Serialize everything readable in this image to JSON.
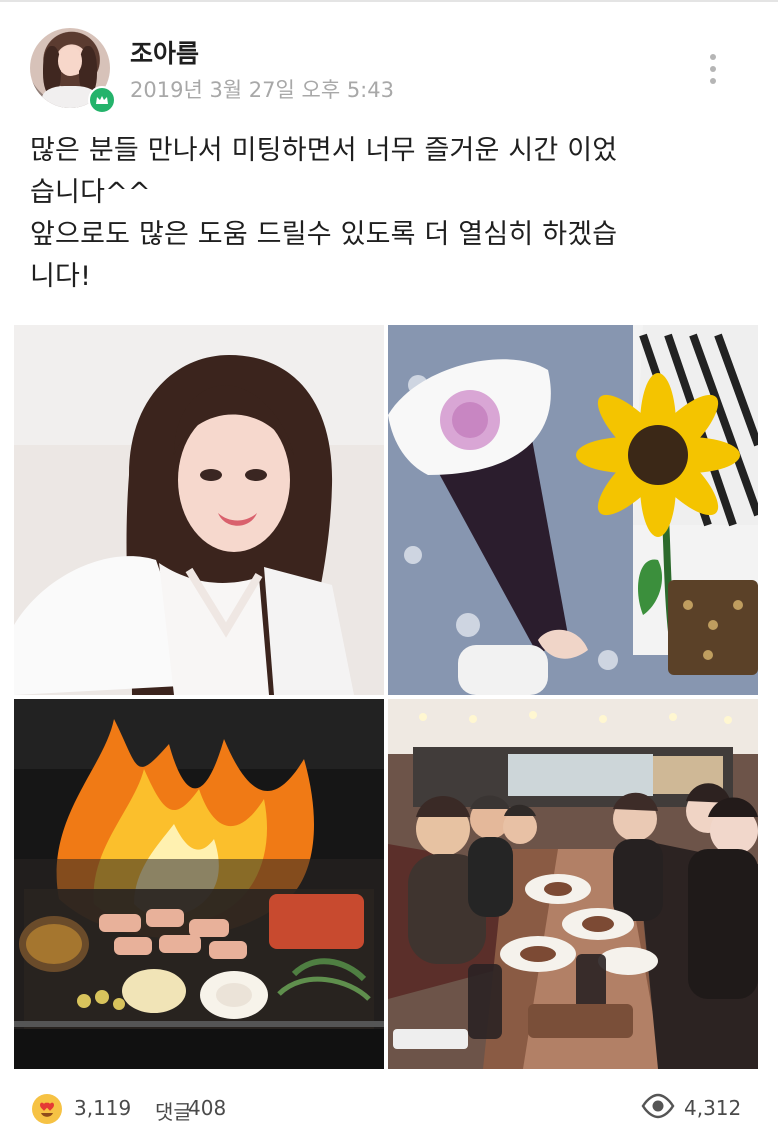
{
  "post": {
    "username": "조아름",
    "timestamp": "2019년 3월 27일 오후 5:43",
    "text": "많은 분들 만나서 미팅하면서 너무 즐거운 시간 이었\n습니다^^\n앞으로도 많은 도움 드릴수 있도록 더 열심히 하겠습\n니다!"
  },
  "photos": [
    {
      "label": "selfie-photo"
    },
    {
      "label": "flowers-photo"
    },
    {
      "label": "grill-photo"
    },
    {
      "label": "restaurant-photo"
    }
  ],
  "footer": {
    "reactions": "3,119",
    "comments_label": "댓글",
    "comments": "408",
    "views": "4,312"
  },
  "icons": {
    "avatar": "avatar",
    "badge": "crown-icon",
    "more": "more-vertical-icon",
    "reaction": "heart-eyes-emoji-icon",
    "views": "eye-icon"
  },
  "colors": {
    "badge_green": "#24b36b",
    "text_dark": "#1f1f1f",
    "text_muted": "#a8a8a8"
  }
}
